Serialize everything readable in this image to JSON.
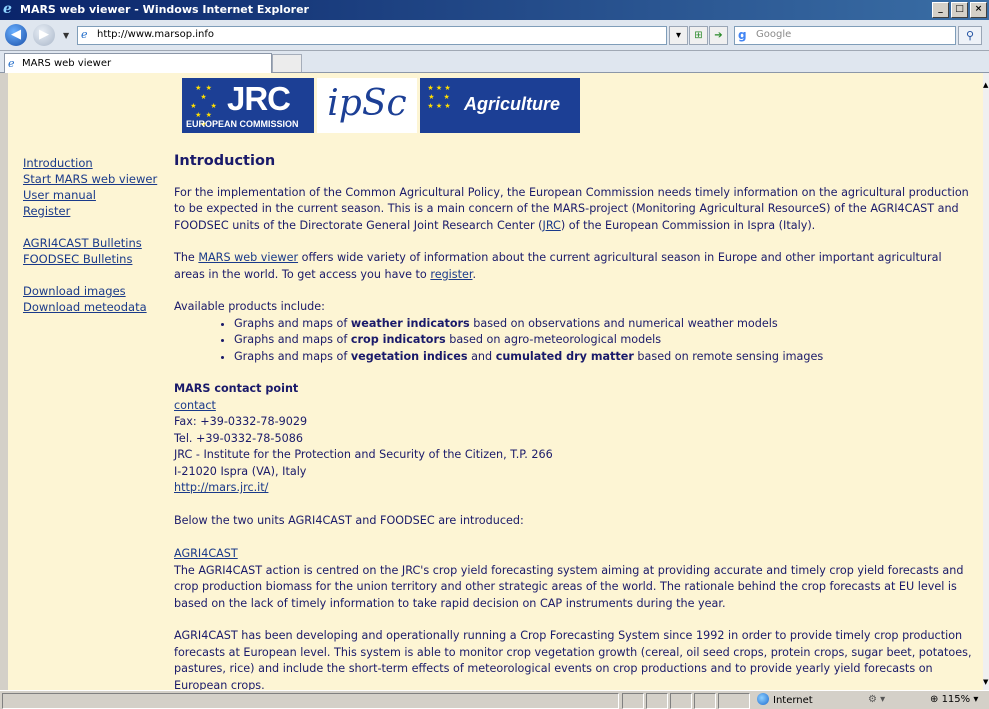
{
  "window": {
    "title": "MARS web viewer - Windows Internet Explorer"
  },
  "toolbar": {
    "url": "http://www.marsop.info",
    "search_placeholder": "Google"
  },
  "tab": {
    "label": "MARS web viewer"
  },
  "banner": {
    "jrc": "JRC",
    "ec": "EUROPEAN COMMISSION",
    "ipsc": "ipSc",
    "agri": "Agriculture"
  },
  "nav": {
    "items": [
      "Introduction",
      "Start MARS web viewer",
      "User manual",
      "Register",
      "AGRI4CAST Bulletins",
      "FOODSEC Bulletins",
      "Download images",
      "Download meteodata"
    ]
  },
  "main": {
    "title": "Introduction",
    "p1_a": "For the implementation of the Common Agricultural Policy, the European Commission needs timely information on the agricultural production to be expected in the current season. This is a main concern of the MARS-project (Monitoring Agricultural ResourceS) of the AGRI4CAST and FOODSEC units of the Directorate General Joint Research Center (",
    "p1_link": "JRC",
    "p1_b": ") of the European Commission in Ispra (Italy).",
    "p2_a": "The ",
    "p2_link": "MARS web viewer",
    "p2_b": " offers wide variety of information about the current agricultural season in Europe and other important agricultural areas in the world. To get access you have to ",
    "p2_link2": "register",
    "p2_c": ".",
    "products_intro": "Available products include:",
    "products": [
      {
        "pre": "Graphs and maps of ",
        "bold": "weather indicators",
        "post": " based on observations and numerical weather models",
        "bold2": "",
        "post2": ""
      },
      {
        "pre": "Graphs and maps of ",
        "bold": "crop indicators",
        "post": " based on agro-meteorological models",
        "bold2": "",
        "post2": ""
      },
      {
        "pre": "Graphs and maps of ",
        "bold": "vegetation indices",
        "post": " and ",
        "bold2": "cumulated dry matter",
        "post2": " based on remote sensing images"
      }
    ],
    "contact_title": "MARS contact point",
    "contact_link": "contact",
    "fax": "Fax: +39-0332-78-9029",
    "tel": "Tel. +39-0332-78-5086",
    "inst": "JRC - Institute for the Protection and Security of the Citizen, T.P. 266",
    "addr": "I-21020 Ispra (VA), Italy",
    "site": "http://mars.jrc.it/",
    "units_intro": "Below the two units AGRI4CAST and FOODSEC are introduced:",
    "agri4cast_link": "AGRI4CAST",
    "agri4cast_p1": "The AGRI4CAST action is centred on the JRC's crop yield forecasting system aiming at providing accurate and timely crop yield forecasts and crop production biomass for the union territory and other strategic areas of the world. The rationale behind the crop forecasts at EU level is based on the lack of timely information to take rapid decision on CAP instruments during the year.",
    "agri4cast_p2": "AGRI4CAST has been developing and operationally running a Crop Forecasting System since 1992 in order to provide timely crop production forecasts at European level. This system is able to monitor crop vegetation growth (cereal, oil seed crops, protein crops, sugar beet, potatoes, pastures, rice) and include the short-term effects of meteorological events on crop productions and to provide yearly yield forecasts on European crops."
  },
  "status": {
    "zone": "Internet",
    "zoom": "115%"
  }
}
